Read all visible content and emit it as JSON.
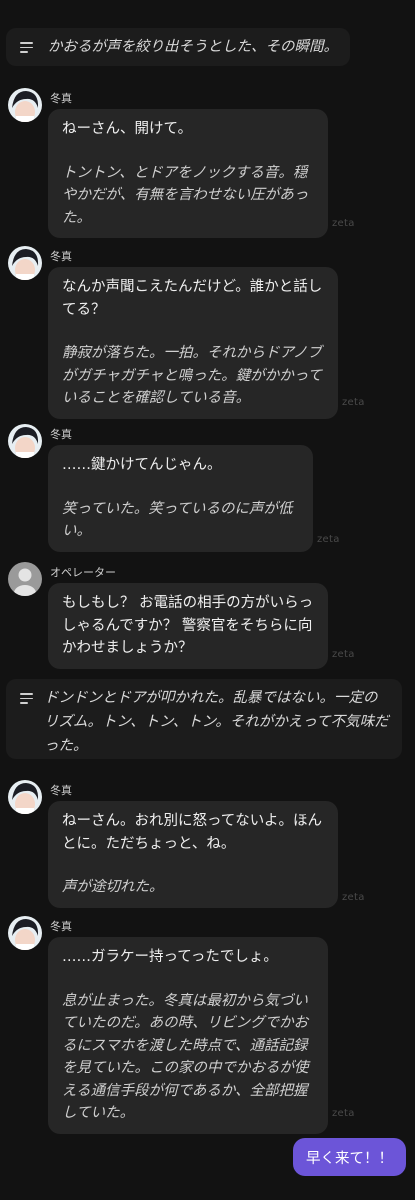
{
  "narrations": [
    {
      "text": "かおるが声を絞り出そうとした、その瞬間。",
      "icon": "narration-icon"
    },
    {
      "text": "ドンドンとドアが叩かれた。乱暴ではない。一定のリズム。トン、トン、トン。それがかえって不気味だった。",
      "icon": "narration-icon"
    }
  ],
  "messages": [
    {
      "sender": "冬真",
      "said": "ねーさん、開けて。",
      "desc": "トントン、とドアをノックする音。穏やかだが、有無を言わせない圧があった。"
    },
    {
      "sender": "冬真",
      "said": "なんか声聞こえたんだけど。誰かと話してる？",
      "desc": "静寂が落ちた。一拍。それからドアノブがガチャガチャと鳴った。鍵がかかっていることを確認している音。"
    },
    {
      "sender": "冬真",
      "said": "……鍵かけてんじゃん。",
      "desc": "笑っていた。笑っているのに声が低い。"
    },
    {
      "sender": "オペレーター",
      "said": "もしもし？ お電話の相手の方がいらっしゃるんですか？ 警察官をそちらに向かわせましょうか？",
      "desc": ""
    },
    {
      "sender": "冬真",
      "said": "ねーさん。おれ別に怒ってないよ。ほんとに。ただちょっと、ね。",
      "desc": "声が途切れた。"
    },
    {
      "sender": "冬真",
      "said": "……ガラケー持ってったでしょ。",
      "desc": "息が止まった。冬真は最初から気づいていたのだ。あの時、リビングでかおるにスマホを渡した時点で、通話記録を見ていた。この家の中でかおるが使える通信手段が何であるか、全部把握していた。"
    }
  ],
  "watermark": "zeta",
  "reply_button": {
    "label": "早く来て！！"
  },
  "colors": {
    "background": "#121212",
    "bubble": "#262626",
    "accent": "#6c55d8"
  }
}
